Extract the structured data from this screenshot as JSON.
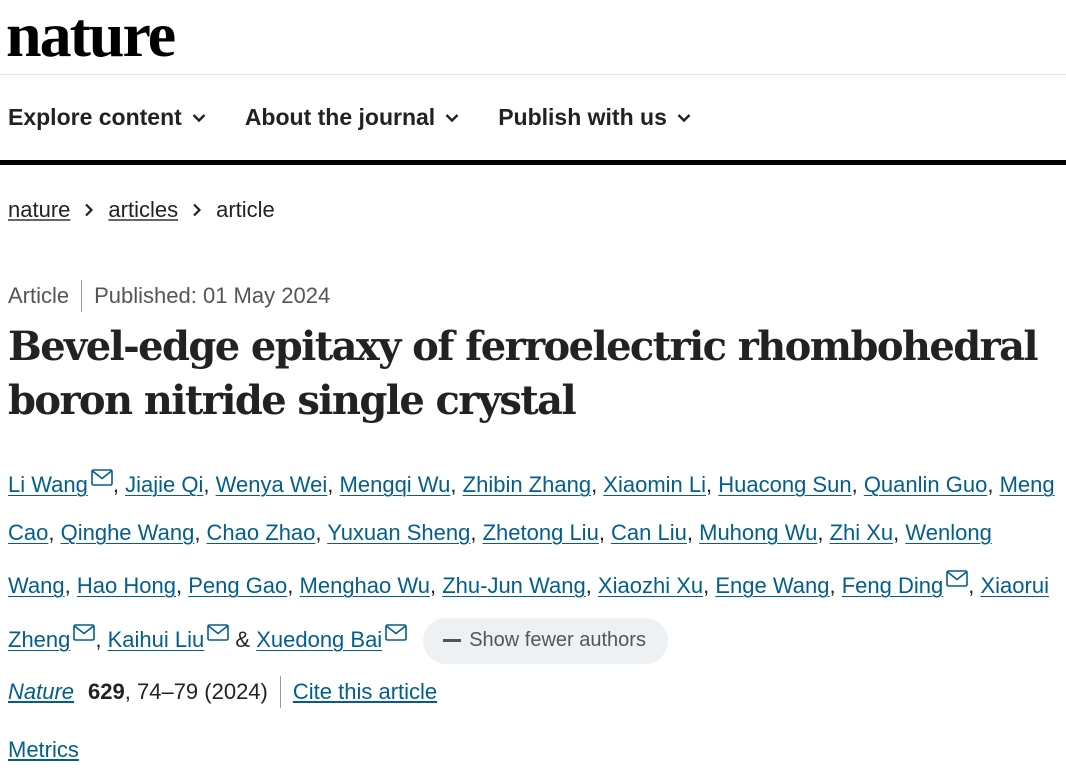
{
  "header": {
    "logo": "nature"
  },
  "nav": {
    "items": [
      {
        "label": "Explore content"
      },
      {
        "label": "About the journal"
      },
      {
        "label": "Publish with us"
      }
    ]
  },
  "breadcrumb": [
    "nature",
    "articles",
    "article"
  ],
  "meta": {
    "type": "Article",
    "published": "Published: 01 May 2024"
  },
  "article": {
    "title_line1": "Bevel-edge epitaxy of ferroelectric rhombohedral",
    "title_line2": "boron nitride single crystal"
  },
  "authors": [
    "Li Wang",
    "Jiajie Qi",
    "Wenya Wei",
    "Mengqi Wu",
    "Zhibin Zhang",
    "Xiaomin Li",
    "Huacong Sun",
    "Quanlin Guo",
    "Meng Cao",
    "Qinghe Wang",
    "Chao Zhao",
    "Yuxuan Sheng",
    "Zhetong Liu",
    "Can Liu",
    "Muhong Wu",
    "Zhi Xu",
    "Wenlong Wang",
    "Hao Hong",
    "Peng Gao",
    "Menghao Wu",
    "Zhu-Jun Wang",
    "Xiaozhi Xu",
    "Enge Wang",
    "Feng Ding",
    "Xiaorui Zheng",
    "Kaihui Liu",
    "Xuedong Bai"
  ],
  "authors_and": "&",
  "show_fewer_label": "Show fewer authors",
  "citation": {
    "journal": "Nature",
    "volume": "629",
    "pages_year": ", 74–79 (2024)",
    "cite_label": "Cite this article"
  },
  "metrics_label": "Metrics",
  "colors": {
    "link": "#025e8d",
    "text": "#222222",
    "muted": "#555555",
    "pill_bg": "#eef1f4"
  }
}
